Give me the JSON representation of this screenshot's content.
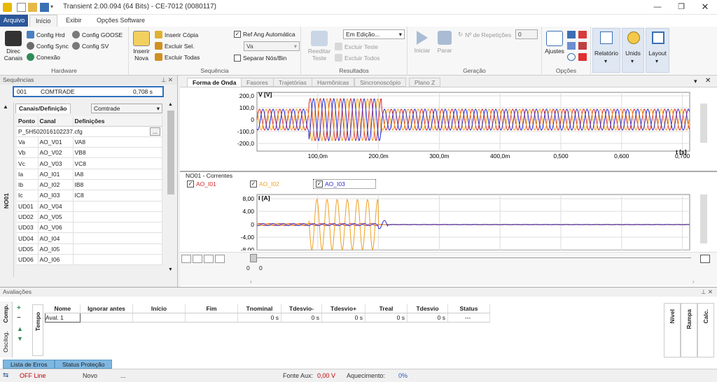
{
  "window": {
    "title": "Transient 2.00.094 (64 Bits) - CE-7012 (0080117)"
  },
  "ribbon_tabs": [
    "Arquivo",
    "Início",
    "Exibir",
    "Opções Software"
  ],
  "hardware": {
    "direc": "Direc Canais",
    "config_hrd": "Config Hrd",
    "config_sync": "Config Sync",
    "conexao": "Conexão",
    "config_goose": "Config GOOSE",
    "config_sv": "Config SV",
    "label": "Hardware"
  },
  "sequencia": {
    "inserir_nova": "Inserir Nova",
    "inserir_copia": "Inserir Cópia",
    "excluir_sel": "Excluir Sel.",
    "excluir_todas": "Excluir Todas",
    "ref_ang": "Ref Ang Automática",
    "ref_value": "Va",
    "separar": "Separar Nós/Bin",
    "label": "Sequência"
  },
  "resultados": {
    "reeditar": "Reeditar Teste",
    "status_combo": "Em Edição...",
    "excluir_teste": "Excluir Teste",
    "excluir_todos": "Excluir Todos",
    "label": "Resultados"
  },
  "geracao": {
    "iniciar": "Iniciar",
    "parar": "Parar",
    "repeticoes_label": "Nº de Repetições",
    "repeticoes": "0",
    "label": "Geração"
  },
  "opcoes": {
    "ajustes": "Ajustes",
    "label": "Opções"
  },
  "right_ribbon": {
    "relatorio": "Relatório",
    "unids": "Unids",
    "layout": "Layout"
  },
  "sequencias": {
    "header": "Sequências",
    "id": "001",
    "name": "COMTRADE",
    "time": "0,708 s",
    "tab": "Canais/Definição",
    "type": "Comtrade",
    "node": "NO01",
    "cols": [
      "Ponto",
      "Canal",
      "Definições"
    ],
    "file": "P_5H502016102237.cfg",
    "rows": [
      [
        "Va",
        "AO_V01",
        "VA8"
      ],
      [
        "Vb",
        "AO_V02",
        "VB8"
      ],
      [
        "Vc",
        "AO_V03",
        "VC8"
      ],
      [
        "Ia",
        "AO_I01",
        "IA8"
      ],
      [
        "Ib",
        "AO_I02",
        "IB8"
      ],
      [
        "Ic",
        "AO_I03",
        "IC8"
      ],
      [
        "UD01",
        "AO_V04",
        ""
      ],
      [
        "UD02",
        "AO_V05",
        ""
      ],
      [
        "UD03",
        "AO_V06",
        ""
      ],
      [
        "UD04",
        "AO_I04",
        ""
      ],
      [
        "UD05",
        "AO_I05",
        ""
      ],
      [
        "UD06",
        "AO_I06",
        ""
      ]
    ]
  },
  "content_tabs": [
    "Forma de Onda",
    "Fasores",
    "Trajetórias",
    "Harmônicas",
    "Sincronoscópio",
    "Plano Z"
  ],
  "voltage_plot": {
    "ylabel": "V [V]",
    "xlabel": "t [s]",
    "yticks": [
      "200,0",
      "100,0",
      "0",
      "-100,0",
      "-200,0"
    ],
    "xticks": [
      "100,0m",
      "200,0m",
      "300,0m",
      "400,0m",
      "0,500",
      "0,600",
      "0,700"
    ]
  },
  "current_plot": {
    "title": "NO01 - Correntes",
    "ylabel": "I [A]",
    "yticks": [
      "8,00",
      "4,00",
      "0",
      "-4,00",
      "-8,00"
    ],
    "legend": [
      "AO_I01",
      "AO_I02",
      "AO_I03"
    ],
    "legend_colors": [
      "#d62728",
      "#f0a020",
      "#2b2bd0"
    ]
  },
  "timeline": {
    "start": "0",
    "end": "0"
  },
  "avaliacoes": {
    "header": "Avaliações",
    "side_tabs": [
      "Comp.",
      "Oscilog."
    ],
    "tempo": "Tempo",
    "cols": [
      "Nome",
      "Ignorar antes",
      "Início",
      "Fim",
      "Tnominal",
      "Tdesvio-",
      "Tdesvio+",
      "Treal",
      "Tdesvio",
      "Status"
    ],
    "row": [
      "Aval. 1",
      "",
      "",
      "",
      "0 s",
      "0 s",
      "0 s",
      "0 s",
      "0 s",
      "---"
    ],
    "right_tabs": [
      "Nível",
      "Rampa",
      "Calc."
    ],
    "bottom_tabs": [
      "Lista de Erros",
      "Status Proteção"
    ]
  },
  "status_bar": {
    "line": "OFF Line",
    "novo": "Novo",
    "dots": "...",
    "fonte_label": "Fonte Aux:",
    "fonte_value": "0,00 V",
    "aquec_label": "Aquecimento:",
    "aquec_value": "0%"
  }
}
